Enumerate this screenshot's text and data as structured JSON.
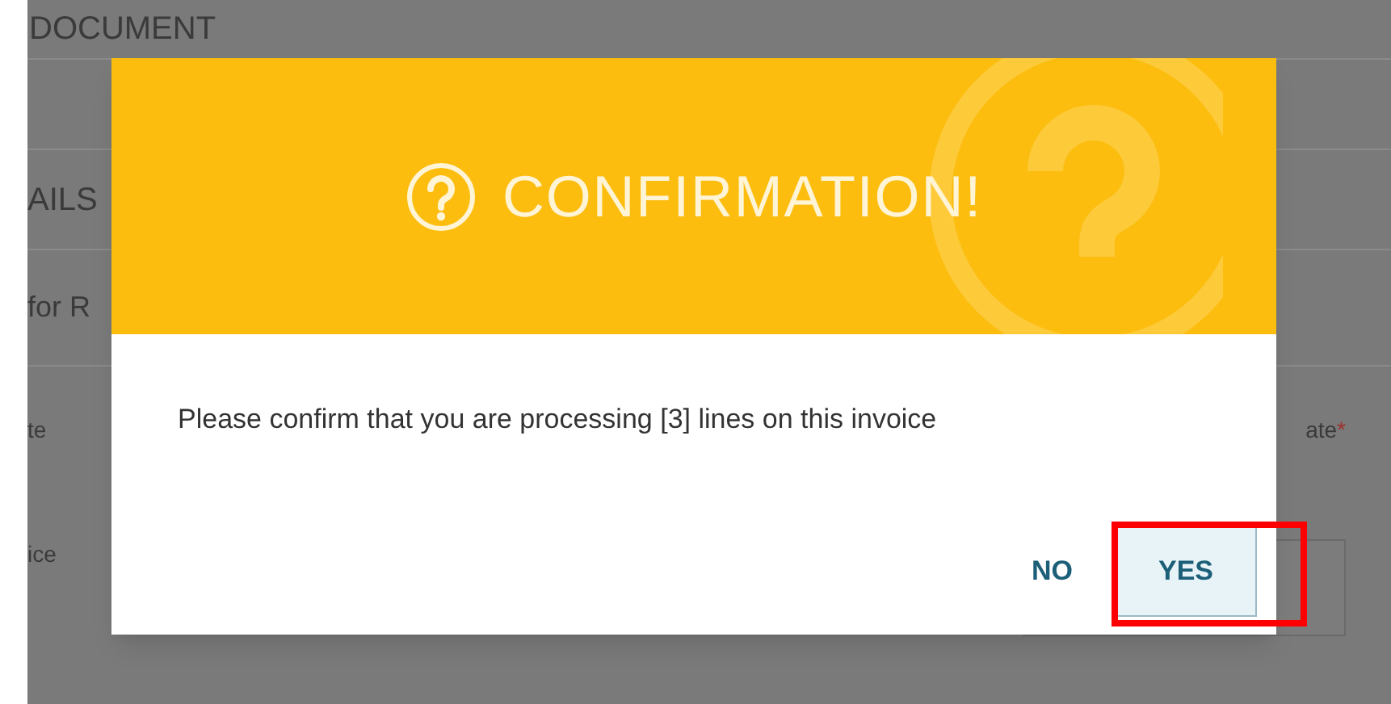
{
  "background": {
    "heading": "DOCUMENT",
    "section": "AILS",
    "subsection": "for R",
    "field_labels": [
      {
        "text": "te"
      },
      {
        "text": "ice"
      },
      {
        "text": "ate",
        "required_marker": "*"
      }
    ]
  },
  "dialog": {
    "title": "CONFIRMATION!",
    "message": "Please confirm that you are processing [3] lines on this invoice",
    "buttons": [
      {
        "label": "NO",
        "selected": false,
        "highlighted": false
      },
      {
        "label": "YES",
        "selected": true,
        "highlighted": true
      }
    ]
  }
}
